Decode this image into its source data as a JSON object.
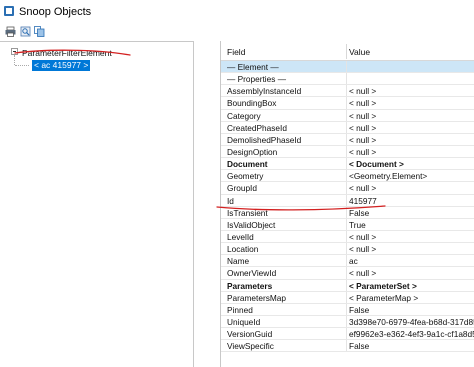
{
  "window": {
    "title": "Snoop Objects"
  },
  "toolbar": {
    "buttons": [
      {
        "icon": "print-icon"
      },
      {
        "icon": "print-preview-icon"
      },
      {
        "icon": "copy-icon"
      }
    ]
  },
  "tree": {
    "root_label": "ParameterFilterElement",
    "child_label": "< ac  415977 >"
  },
  "grid": {
    "col_field": "Field",
    "col_value": "Value",
    "rows": [
      {
        "field": "— Element —",
        "value": "",
        "kind": "section-hl"
      },
      {
        "field": "— Properties —",
        "value": "",
        "kind": "section"
      },
      {
        "field": "AssemblyInstanceId",
        "value": "< null >",
        "kind": ""
      },
      {
        "field": "BoundingBox",
        "value": "< null >",
        "kind": ""
      },
      {
        "field": "Category",
        "value": "< null >",
        "kind": ""
      },
      {
        "field": "CreatedPhaseId",
        "value": "< null >",
        "kind": ""
      },
      {
        "field": "DemolishedPhaseId",
        "value": "< null >",
        "kind": ""
      },
      {
        "field": "DesignOption",
        "value": "< null >",
        "kind": ""
      },
      {
        "field": "Document",
        "value": "< Document >",
        "kind": "bold"
      },
      {
        "field": "Geometry",
        "value": "<Geometry.Element>",
        "kind": ""
      },
      {
        "field": "GroupId",
        "value": "< null >",
        "kind": ""
      },
      {
        "field": "Id",
        "value": "415977",
        "kind": ""
      },
      {
        "field": "IsTransient",
        "value": "False",
        "kind": ""
      },
      {
        "field": "IsValidObject",
        "value": "True",
        "kind": ""
      },
      {
        "field": "LevelId",
        "value": "< null >",
        "kind": ""
      },
      {
        "field": "Location",
        "value": "< null >",
        "kind": ""
      },
      {
        "field": "Name",
        "value": "ac",
        "kind": ""
      },
      {
        "field": "OwnerViewId",
        "value": "< null >",
        "kind": ""
      },
      {
        "field": "Parameters",
        "value": "< ParameterSet >",
        "kind": "bold"
      },
      {
        "field": "ParametersMap",
        "value": "< ParameterMap >",
        "kind": ""
      },
      {
        "field": "Pinned",
        "value": "False",
        "kind": ""
      },
      {
        "field": "UniqueId",
        "value": "3d398e70-6979-4fea-b68d-317d85",
        "kind": ""
      },
      {
        "field": "VersionGuid",
        "value": "ef9962e3-e362-4ef3-9a1c-cf1a8d5",
        "kind": ""
      },
      {
        "field": "ViewSpecific",
        "value": "False",
        "kind": ""
      }
    ]
  },
  "colors": {
    "selection": "#0078d7",
    "section_highlight": "#cde6f7",
    "annotation": "#d32020"
  }
}
